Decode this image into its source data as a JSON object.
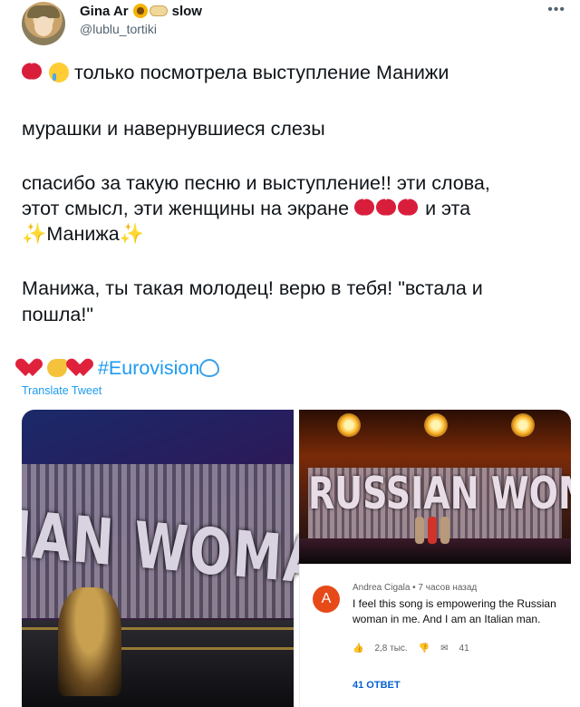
{
  "author": {
    "display_name": "Gina Ar",
    "display_name_suffix": "slow",
    "handle": "@lublu_tortiki",
    "name_emoji": [
      "sunflower-icon",
      "bread-icon"
    ]
  },
  "tweet": {
    "line1": "только посмотрела выступление Манижи",
    "line2": "мурашки и навернувшиеся слезы",
    "line3": "спасибо за такую песню и выступление!! эти слова,",
    "line4a": "этот смысл, эти женщины на экране",
    "line4b": "и эта",
    "line5": "Манижа",
    "line6": "Манижа, ты такая молодец! верю в тебя! \"встала и",
    "line7": "пошла!\"",
    "hashtag": "#Eurovision",
    "translate": "Translate Tweet"
  },
  "media": {
    "left_image_text": "IAN WOMA",
    "right_image_text": "RUSSIAN WOMAN"
  },
  "youtube_comment": {
    "avatar_letter": "A",
    "author": "Andrea Cigala • 7 часов назад",
    "text": "I feel this song is empowering the Russian woman in me. And I am an Italian man.",
    "likes": "2,8 тыс.",
    "reply_count": "41",
    "replies_label": "41 ОТВЕТ"
  },
  "colors": {
    "link": "#1d9bf0",
    "text": "#0f1419",
    "muted": "#536471",
    "youtube_blue": "#065fd4"
  }
}
